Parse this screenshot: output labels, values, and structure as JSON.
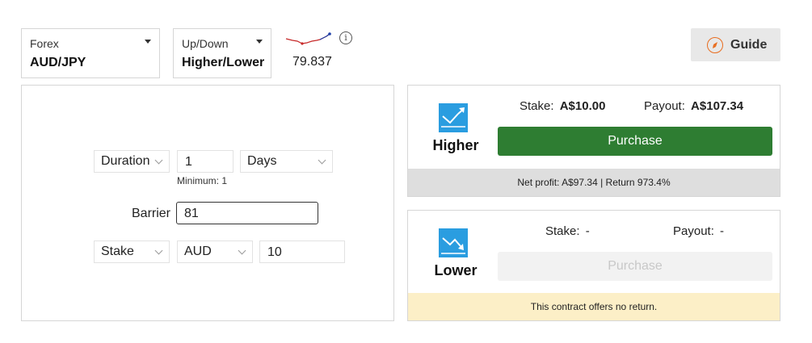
{
  "market": {
    "category": "Forex",
    "symbol": "AUD/JPY"
  },
  "trade_type": {
    "category": "Up/Down",
    "type": "Higher/Lower"
  },
  "spot": {
    "price": "79.837",
    "info_glyph": "i"
  },
  "guide": {
    "label": "Guide"
  },
  "form": {
    "duration_label": "Duration",
    "duration_value": "1",
    "duration_unit": "Days",
    "duration_minimum": "Minimum: 1",
    "barrier_label": "Barrier",
    "barrier_value": "81",
    "stake_label": "Stake",
    "currency": "AUD",
    "stake_value": "10"
  },
  "higher": {
    "name": "Higher",
    "stake_label": "Stake:",
    "stake_value": "A$10.00",
    "payout_label": "Payout:",
    "payout_value": "A$107.34",
    "purchase_label": "Purchase",
    "footer": "Net profit:  A$97.34 | Return 973.4%",
    "button_color": "#2e7d32",
    "footer_bg": "#dedede"
  },
  "lower": {
    "name": "Lower",
    "stake_label": "Stake:",
    "stake_value": "-",
    "payout_label": "Payout:",
    "payout_value": "-",
    "purchase_label": "Purchase",
    "footer": "This contract offers no return.",
    "button_color": "#f2f2f2",
    "footer_bg": "#fcefc7"
  },
  "colors": {
    "icon_blue": "#2a9de0",
    "guide_orange": "#e86d1f",
    "sparkline_red": "#c62828",
    "sparkline_blue": "#1e3fa8"
  }
}
